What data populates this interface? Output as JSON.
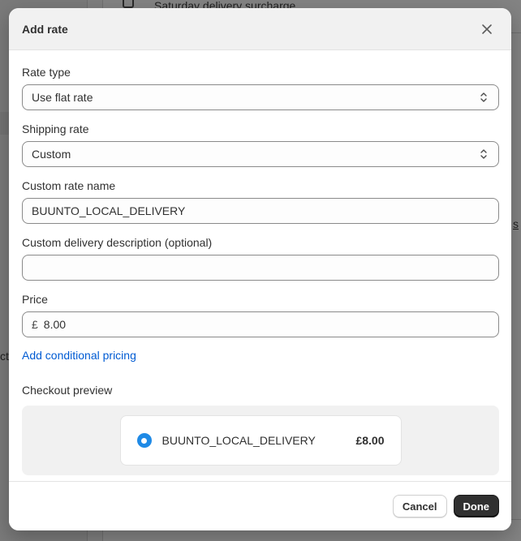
{
  "background": {
    "top_text": "Saturday delivery surcharge",
    "left_fragment": "ct",
    "right_fragment": "s"
  },
  "modal": {
    "title": "Add rate",
    "close_icon": "close-icon",
    "fields": {
      "rate_type": {
        "label": "Rate type",
        "value": "Use flat rate"
      },
      "shipping_rate": {
        "label": "Shipping rate",
        "value": "Custom"
      },
      "custom_rate_name": {
        "label": "Custom rate name",
        "value": "BUUNTO_LOCAL_DELIVERY"
      },
      "description": {
        "label": "Custom delivery description (optional)",
        "value": ""
      },
      "price": {
        "label": "Price",
        "currency": "£",
        "value": "8.00"
      }
    },
    "conditional_pricing_link": "Add conditional pricing",
    "checkout_preview": {
      "label": "Checkout preview",
      "rate_name": "BUUNTO_LOCAL_DELIVERY",
      "rate_price": "£8.00"
    },
    "footer": {
      "cancel_label": "Cancel",
      "done_label": "Done"
    }
  },
  "colors": {
    "link": "#005bd3",
    "radio": "#1f8ae6",
    "primary_button": "#303030"
  }
}
